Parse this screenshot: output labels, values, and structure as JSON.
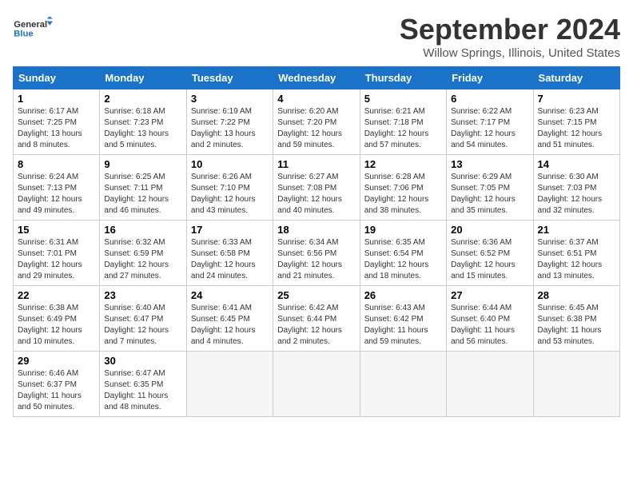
{
  "header": {
    "logo_line1": "General",
    "logo_line2": "Blue",
    "month_title": "September 2024",
    "location": "Willow Springs, Illinois, United States"
  },
  "weekdays": [
    "Sunday",
    "Monday",
    "Tuesday",
    "Wednesday",
    "Thursday",
    "Friday",
    "Saturday"
  ],
  "weeks": [
    [
      {
        "day": "1",
        "sunrise": "6:17 AM",
        "sunset": "7:25 PM",
        "daylight": "13 hours and 8 minutes."
      },
      {
        "day": "2",
        "sunrise": "6:18 AM",
        "sunset": "7:23 PM",
        "daylight": "13 hours and 5 minutes."
      },
      {
        "day": "3",
        "sunrise": "6:19 AM",
        "sunset": "7:22 PM",
        "daylight": "13 hours and 2 minutes."
      },
      {
        "day": "4",
        "sunrise": "6:20 AM",
        "sunset": "7:20 PM",
        "daylight": "12 hours and 59 minutes."
      },
      {
        "day": "5",
        "sunrise": "6:21 AM",
        "sunset": "7:18 PM",
        "daylight": "12 hours and 57 minutes."
      },
      {
        "day": "6",
        "sunrise": "6:22 AM",
        "sunset": "7:17 PM",
        "daylight": "12 hours and 54 minutes."
      },
      {
        "day": "7",
        "sunrise": "6:23 AM",
        "sunset": "7:15 PM",
        "daylight": "12 hours and 51 minutes."
      }
    ],
    [
      {
        "day": "8",
        "sunrise": "6:24 AM",
        "sunset": "7:13 PM",
        "daylight": "12 hours and 49 minutes."
      },
      {
        "day": "9",
        "sunrise": "6:25 AM",
        "sunset": "7:11 PM",
        "daylight": "12 hours and 46 minutes."
      },
      {
        "day": "10",
        "sunrise": "6:26 AM",
        "sunset": "7:10 PM",
        "daylight": "12 hours and 43 minutes."
      },
      {
        "day": "11",
        "sunrise": "6:27 AM",
        "sunset": "7:08 PM",
        "daylight": "12 hours and 40 minutes."
      },
      {
        "day": "12",
        "sunrise": "6:28 AM",
        "sunset": "7:06 PM",
        "daylight": "12 hours and 38 minutes."
      },
      {
        "day": "13",
        "sunrise": "6:29 AM",
        "sunset": "7:05 PM",
        "daylight": "12 hours and 35 minutes."
      },
      {
        "day": "14",
        "sunrise": "6:30 AM",
        "sunset": "7:03 PM",
        "daylight": "12 hours and 32 minutes."
      }
    ],
    [
      {
        "day": "15",
        "sunrise": "6:31 AM",
        "sunset": "7:01 PM",
        "daylight": "12 hours and 29 minutes."
      },
      {
        "day": "16",
        "sunrise": "6:32 AM",
        "sunset": "6:59 PM",
        "daylight": "12 hours and 27 minutes."
      },
      {
        "day": "17",
        "sunrise": "6:33 AM",
        "sunset": "6:58 PM",
        "daylight": "12 hours and 24 minutes."
      },
      {
        "day": "18",
        "sunrise": "6:34 AM",
        "sunset": "6:56 PM",
        "daylight": "12 hours and 21 minutes."
      },
      {
        "day": "19",
        "sunrise": "6:35 AM",
        "sunset": "6:54 PM",
        "daylight": "12 hours and 18 minutes."
      },
      {
        "day": "20",
        "sunrise": "6:36 AM",
        "sunset": "6:52 PM",
        "daylight": "12 hours and 15 minutes."
      },
      {
        "day": "21",
        "sunrise": "6:37 AM",
        "sunset": "6:51 PM",
        "daylight": "12 hours and 13 minutes."
      }
    ],
    [
      {
        "day": "22",
        "sunrise": "6:38 AM",
        "sunset": "6:49 PM",
        "daylight": "12 hours and 10 minutes."
      },
      {
        "day": "23",
        "sunrise": "6:40 AM",
        "sunset": "6:47 PM",
        "daylight": "12 hours and 7 minutes."
      },
      {
        "day": "24",
        "sunrise": "6:41 AM",
        "sunset": "6:45 PM",
        "daylight": "12 hours and 4 minutes."
      },
      {
        "day": "25",
        "sunrise": "6:42 AM",
        "sunset": "6:44 PM",
        "daylight": "12 hours and 2 minutes."
      },
      {
        "day": "26",
        "sunrise": "6:43 AM",
        "sunset": "6:42 PM",
        "daylight": "11 hours and 59 minutes."
      },
      {
        "day": "27",
        "sunrise": "6:44 AM",
        "sunset": "6:40 PM",
        "daylight": "11 hours and 56 minutes."
      },
      {
        "day": "28",
        "sunrise": "6:45 AM",
        "sunset": "6:38 PM",
        "daylight": "11 hours and 53 minutes."
      }
    ],
    [
      {
        "day": "29",
        "sunrise": "6:46 AM",
        "sunset": "6:37 PM",
        "daylight": "11 hours and 50 minutes."
      },
      {
        "day": "30",
        "sunrise": "6:47 AM",
        "sunset": "6:35 PM",
        "daylight": "11 hours and 48 minutes."
      },
      null,
      null,
      null,
      null,
      null
    ]
  ]
}
